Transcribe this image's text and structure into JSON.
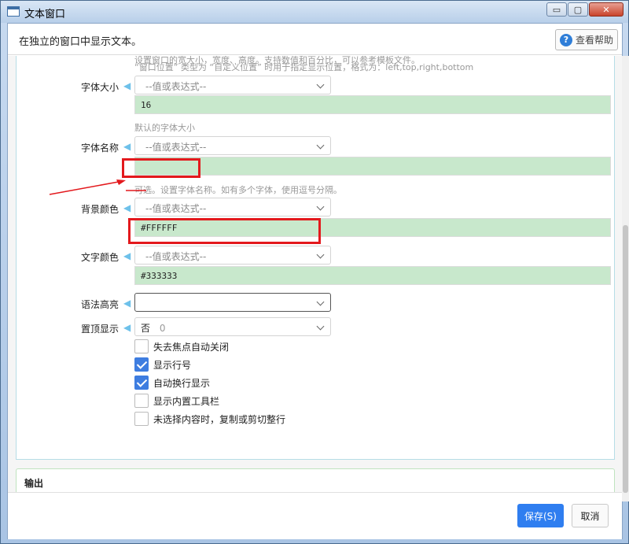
{
  "window": {
    "title": "文本窗口",
    "description": "在独立的窗口中显示文本。",
    "help_label": "查看帮助",
    "controls": {
      "minimize": "▭",
      "maximize": "▢",
      "close": "✕"
    }
  },
  "form": {
    "top_hint_line1": "设置窗口的宽大小，宽度、高度。支持数值和百分比，可以参考模板文件。",
    "top_hint_line2": "“窗口位置” 类型为 “自定义位置” 时用于指定显示位置，格式为：left,top,right,bottom",
    "font_size": {
      "label": "字体大小",
      "select_placeholder": "--值或表达式--",
      "value": "16",
      "hint": "默认的字体大小"
    },
    "font_name": {
      "label": "字体名称",
      "select_placeholder": "--值或表达式--",
      "value": "",
      "hint": "可选。设置字体名称。如有多个字体，使用逗号分隔。"
    },
    "bg_color": {
      "label": "背景颜色",
      "select_placeholder": "--值或表达式--",
      "value": "#FFFFFF"
    },
    "text_color": {
      "label": "文字颜色",
      "select_placeholder": "--值或表达式--",
      "value": "#333333"
    },
    "syntax_highlight": {
      "label": "语法高亮",
      "value": ""
    },
    "topmost": {
      "label": "置顶显示",
      "value": "否",
      "code": "0"
    },
    "checkboxes": [
      {
        "label": "失去焦点自动关闭",
        "checked": false
      },
      {
        "label": "显示行号",
        "checked": true
      },
      {
        "label": "自动换行显示",
        "checked": true
      },
      {
        "label": "显示内置工具栏",
        "checked": false
      },
      {
        "label": "未选择内容时，复制或剪切整行",
        "checked": false
      }
    ]
  },
  "output": {
    "title": "输出"
  },
  "footer": {
    "save_label": "保存(S)",
    "cancel_label": "取消"
  },
  "colors": {
    "accent": "#2f7ef0",
    "value_bg": "#c8e8cc",
    "annotation_red": "#e3191d"
  }
}
